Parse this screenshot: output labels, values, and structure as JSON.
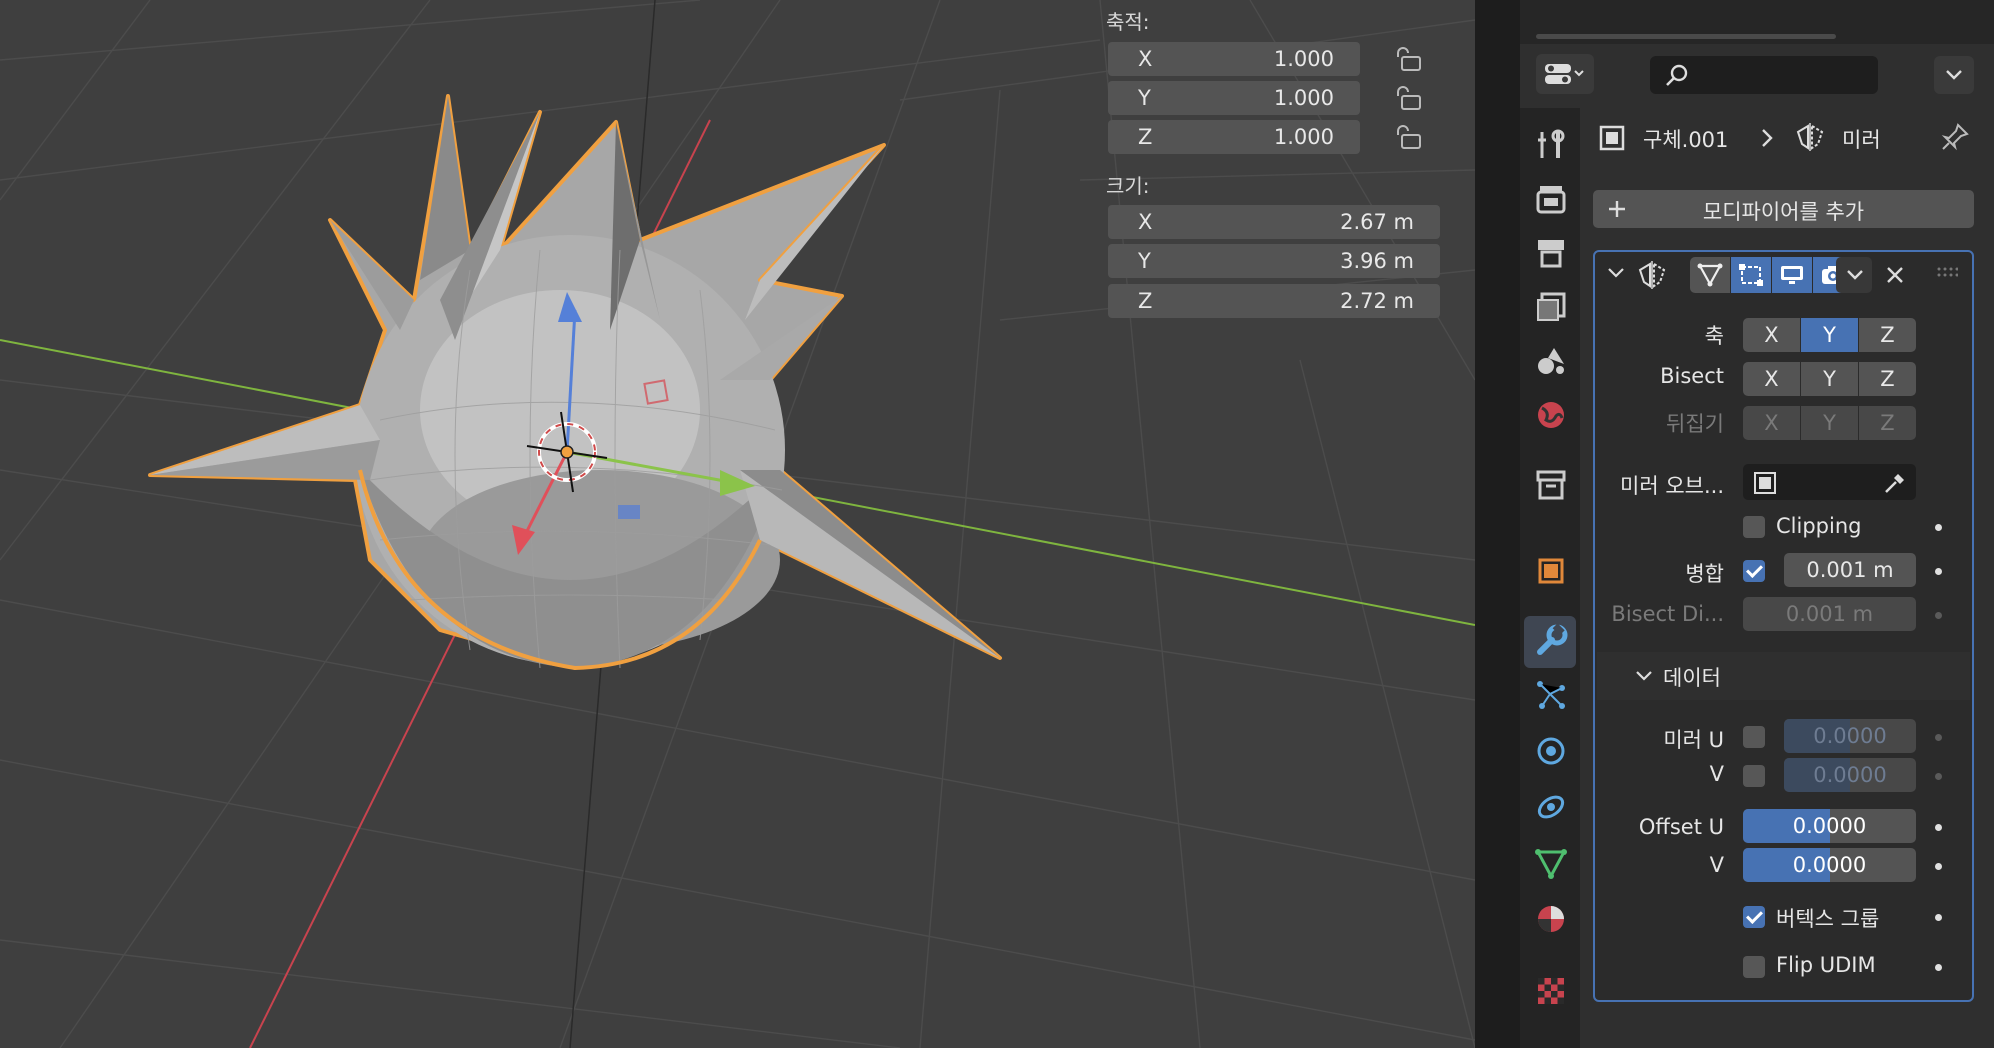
{
  "viewport": {
    "rotation_panel": {
      "label": "축적:",
      "rows": [
        {
          "axis": "X",
          "value": "1.000"
        },
        {
          "axis": "Y",
          "value": "1.000"
        },
        {
          "axis": "Z",
          "value": "1.000"
        }
      ]
    },
    "dimensions_panel": {
      "label": "크기:",
      "rows": [
        {
          "axis": "X",
          "value": "2.67 m"
        },
        {
          "axis": "Y",
          "value": "3.96 m"
        },
        {
          "axis": "Z",
          "value": "2.72 m"
        }
      ]
    }
  },
  "properties": {
    "breadcrumb": {
      "object": "구체.001",
      "modifier": "미러"
    },
    "add_modifier_label": "모디파이어를 추가",
    "tabs": [
      "tool-icon",
      "render-icon",
      "output-icon",
      "view-layer-icon",
      "scene-icon",
      "world-icon",
      "collection-icon",
      "object-icon",
      "modifier-icon",
      "particles-icon",
      "physics-icon",
      "constraints-icon",
      "data-icon",
      "material-icon",
      "texture-icon"
    ],
    "active_tab": "modifier-icon",
    "mirror": {
      "axis_label": "축",
      "bisect_label": "Bisect",
      "flip_label": "뒤집기",
      "axes": [
        "X",
        "Y",
        "Z"
      ],
      "axis_selected": "Y",
      "mirror_object_label": "미러 오브...",
      "clipping_label": "Clipping",
      "merge_label": "병합",
      "merge_value": "0.001 m",
      "bisect_distance_label": "Bisect Di...",
      "bisect_distance_value": "0.001 m",
      "data_section_label": "데이터",
      "mirror_u_label": "미러 U",
      "mirror_u_value": "0.0000",
      "v_label": "V",
      "mirror_v_value": "0.0000",
      "offset_u_label": "Offset U",
      "offset_u_value": "0.0000",
      "offset_v_value": "0.0000",
      "vertex_groups_label": "버텍스 그룹",
      "flip_udim_label": "Flip UDIM"
    }
  },
  "colors": {
    "accent": "#4772b3",
    "selection_outline": "#f0a040",
    "x_axis": "#c8434e",
    "y_axis": "#7fb53f"
  }
}
